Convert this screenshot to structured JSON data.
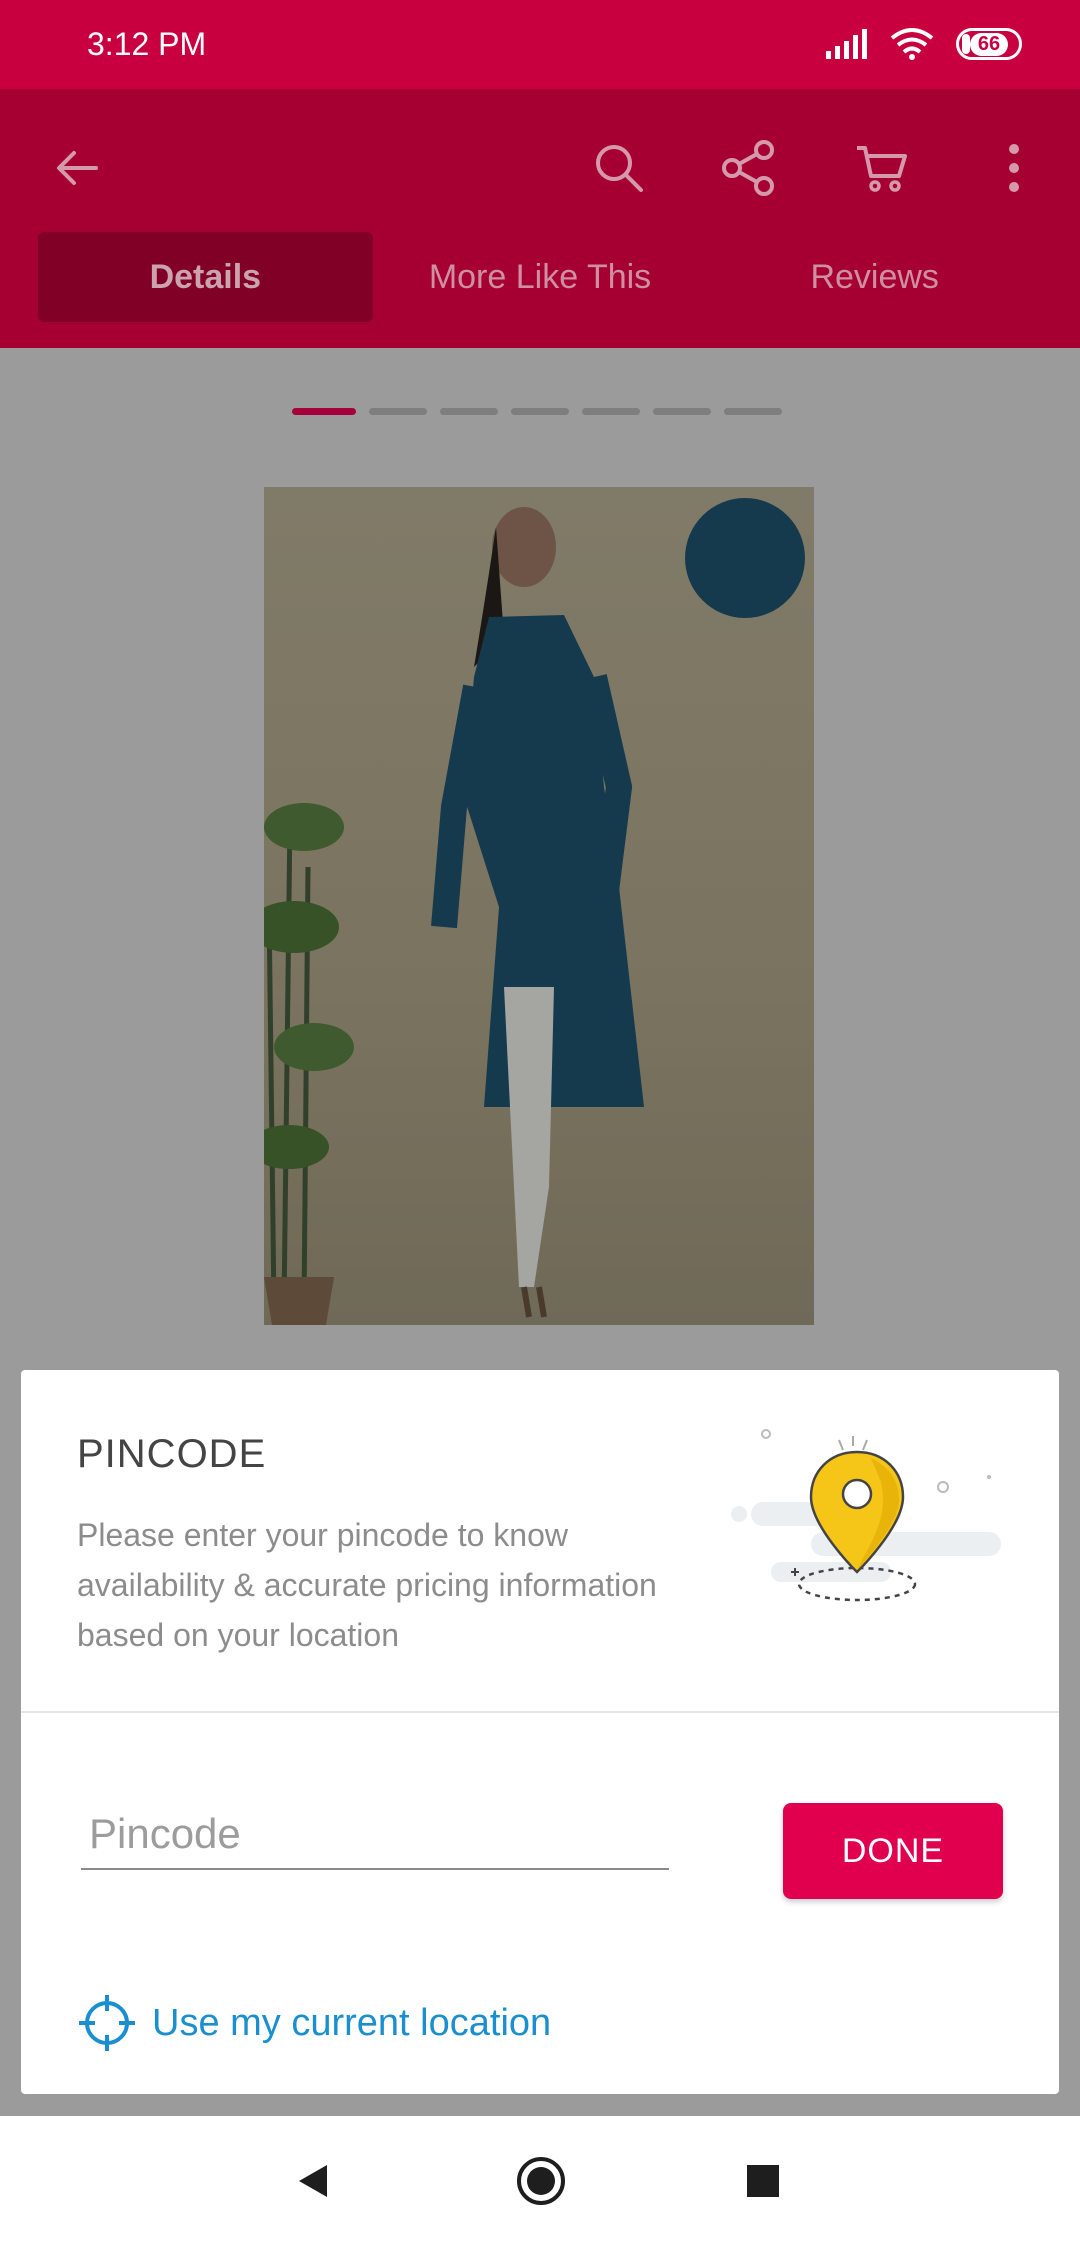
{
  "status_bar": {
    "time": "3:12 PM",
    "battery": "66"
  },
  "app_bar": {
    "icons": [
      "back-arrow-icon",
      "search-icon",
      "share-icon",
      "cart-icon",
      "more-vert-icon"
    ],
    "tabs": [
      {
        "label": "Details",
        "active": true
      },
      {
        "label": "More Like This",
        "active": false
      },
      {
        "label": "Reviews",
        "active": false
      }
    ]
  },
  "carousel": {
    "count": 7,
    "active_index": 0
  },
  "pincode_dialog": {
    "title": "PINCODE",
    "description": "Please enter your pincode to know availability & accurate pricing information based on your location",
    "input_placeholder": "Pincode",
    "input_value": "",
    "done_label": "DONE",
    "location_label": "Use my current location"
  },
  "colors": {
    "primary": "#e1004d",
    "status_bar": "#c8003f",
    "link": "#1a8fd0",
    "pin": "#f5c518"
  }
}
